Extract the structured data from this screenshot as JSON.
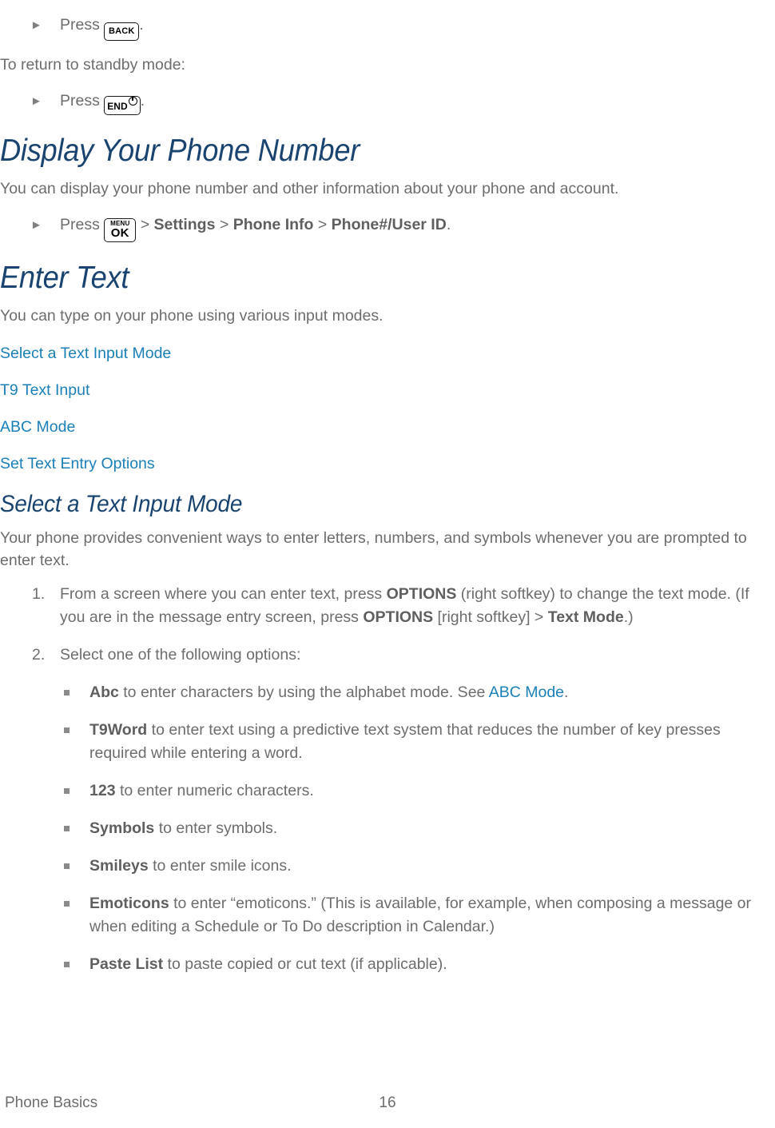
{
  "colors": {
    "heading": "#1a4470",
    "link": "#1b80b8",
    "body_text": "#6d6d6d",
    "bullet": "#8a8a8a",
    "arrow_marker": "#808080",
    "page_background": "#ffffff"
  },
  "keys": {
    "back": "BACK",
    "end": "END",
    "end_power_icon": "power-symbol",
    "menu_top": "MENU",
    "menu_bottom": "OK"
  },
  "steps_top": {
    "press_back_prefix": "Press",
    "press_back_suffix": ".",
    "standby_intro": "To return to standby mode:",
    "press_end_prefix": "Press",
    "press_end_suffix": "."
  },
  "display_phone_number": {
    "heading": "Display Your Phone Number",
    "intro": "You can display your phone number and other information about your phone and account.",
    "step_prefix": "Press",
    "step_sep1": ">",
    "step_settings": "Settings",
    "step_sep2": ">",
    "step_phone_info": "Phone Info",
    "step_sep3": ">",
    "step_phone_user_id": "Phone#/User ID",
    "step_end": "."
  },
  "enter_text": {
    "heading": "Enter Text",
    "intro": "You can type on your phone using various input modes.",
    "toc": [
      "Select a Text Input Mode",
      "T9 Text Input",
      "ABC Mode",
      "Set Text Entry Options"
    ]
  },
  "select_text_input_mode": {
    "heading": "Select a Text Input Mode",
    "intro": "Your phone provides convenient ways to enter letters, numbers, and symbols whenever you are prompted to enter text.",
    "steps": [
      {
        "number": "1.",
        "part1": "From a screen where you can enter text, press ",
        "bold1": "OPTIONS",
        "part2": " (right softkey) to change the text mode. (If you are in the message entry screen, press ",
        "bold2": "OPTIONS",
        "part3": " [right softkey] > ",
        "bold3": "Text Mode",
        "part4": ".)"
      },
      {
        "number": "2.",
        "part1": "Select one of the following options:",
        "bold1": "",
        "part2": "",
        "bold2": "",
        "part3": "",
        "bold3": "",
        "part4": ""
      }
    ],
    "options": [
      {
        "term": "Abc",
        "text_before_link": " to enter characters by using the alphabet mode. See ",
        "link": "ABC Mode",
        "text_after_link": "."
      },
      {
        "term": "T9Word",
        "text_before_link": " to enter text using a predictive text system that reduces the number of key presses required while entering a word.",
        "link": "",
        "text_after_link": ""
      },
      {
        "term": "123",
        "text_before_link": " to enter numeric characters.",
        "link": "",
        "text_after_link": ""
      },
      {
        "term": "Symbols",
        "text_before_link": " to enter symbols.",
        "link": "",
        "text_after_link": ""
      },
      {
        "term": "Smileys",
        "text_before_link": " to enter smile icons.",
        "link": "",
        "text_after_link": ""
      },
      {
        "term": "Emoticons",
        "text_before_link": " to enter “emoticons.” (This is available, for example, when composing a message or when editing a Schedule or To Do description in Calendar.)",
        "link": "",
        "text_after_link": ""
      },
      {
        "term": "Paste List",
        "text_before_link": " to paste copied or cut text (if applicable).",
        "link": "",
        "text_after_link": ""
      }
    ]
  },
  "footer": {
    "section": "Phone Basics",
    "page_number": "16"
  }
}
